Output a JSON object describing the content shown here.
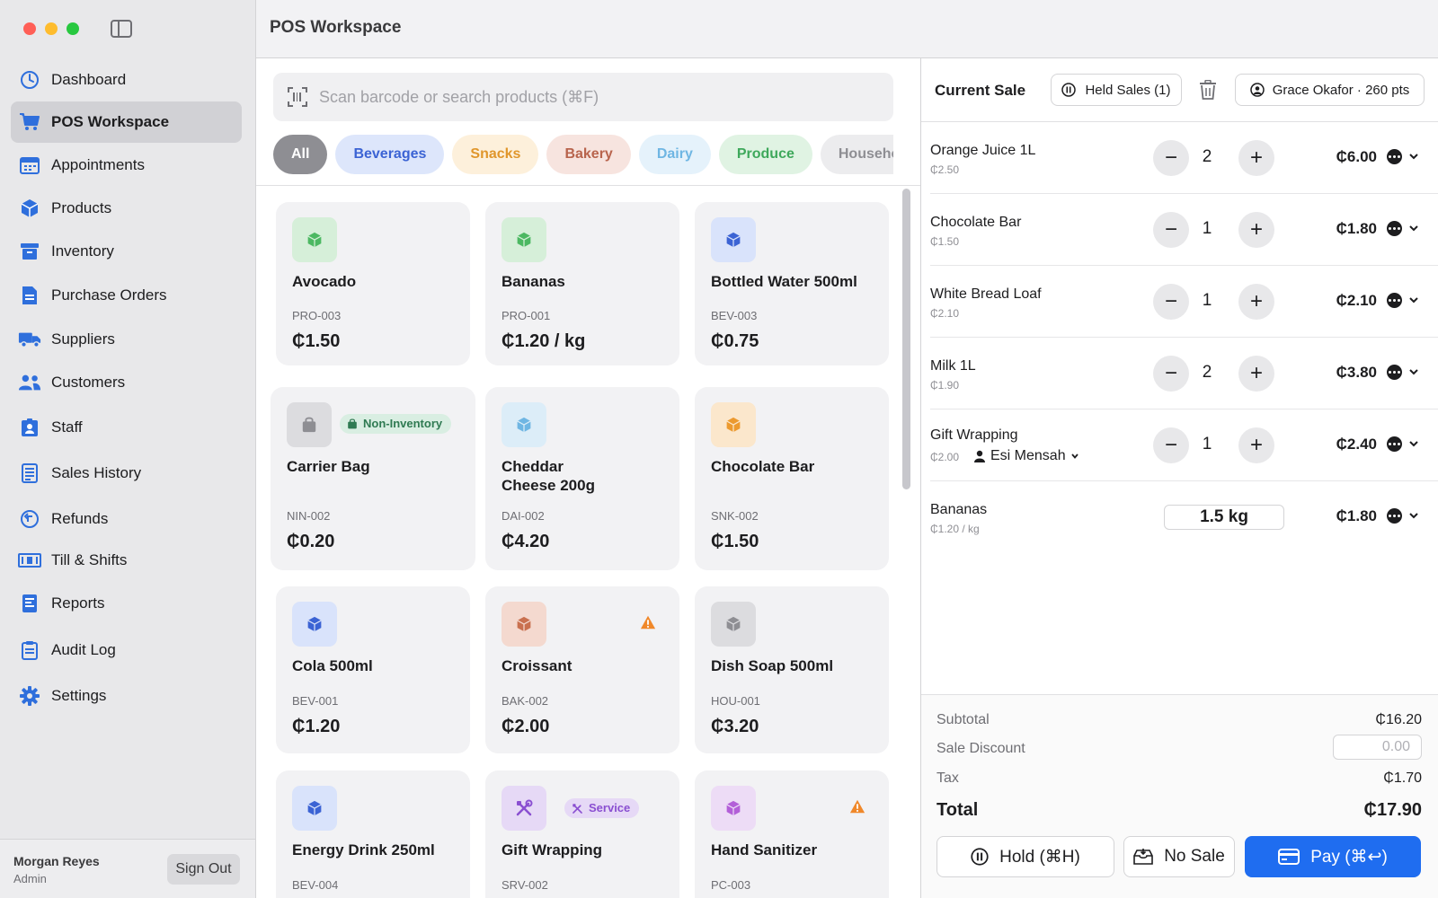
{
  "window": {
    "title": "POS Workspace"
  },
  "sidebar": {
    "items": [
      {
        "label": "Dashboard",
        "icon": "dashboard-gauge-icon"
      },
      {
        "label": "POS Workspace",
        "icon": "cart-icon",
        "active": true
      },
      {
        "label": "Appointments",
        "icon": "calendar-icon"
      },
      {
        "label": "Products",
        "icon": "cube-icon"
      },
      {
        "label": "Inventory",
        "icon": "archive-box-icon"
      },
      {
        "label": "Purchase Orders",
        "icon": "document-icon"
      },
      {
        "label": "Suppliers",
        "icon": "truck-icon"
      },
      {
        "label": "Customers",
        "icon": "people-icon"
      },
      {
        "label": "Staff",
        "icon": "id-badge-icon"
      },
      {
        "label": "Sales History",
        "icon": "receipt-list-icon"
      },
      {
        "label": "Refunds",
        "icon": "refund-arrow-icon"
      },
      {
        "label": "Till & Shifts",
        "icon": "banknote-icon"
      },
      {
        "label": "Reports",
        "icon": "report-icon"
      },
      {
        "label": "Audit Log",
        "icon": "clipboard-icon"
      },
      {
        "label": "Settings",
        "icon": "gear-icon"
      }
    ],
    "user": {
      "name": "Morgan Reyes",
      "role": "Admin",
      "signout_label": "Sign Out"
    }
  },
  "search": {
    "placeholder": "Scan barcode or search products (⌘F)"
  },
  "categories": [
    {
      "label": "All",
      "active": true
    },
    {
      "label": "Beverages"
    },
    {
      "label": "Snacks"
    },
    {
      "label": "Bakery"
    },
    {
      "label": "Dairy"
    },
    {
      "label": "Produce"
    },
    {
      "label": "Household"
    }
  ],
  "products": [
    {
      "name": "Avocado",
      "sku": "PRO-003",
      "price": "₵1.50"
    },
    {
      "name": "Bananas",
      "sku": "PRO-001",
      "price": "₵1.20 / kg"
    },
    {
      "name": "Bottled Water 500ml",
      "sku": "BEV-003",
      "price": "₵0.75"
    },
    {
      "name": "Carrier Bag",
      "sku": "NIN-002",
      "price": "₵0.20",
      "badge": "Non-Inventory"
    },
    {
      "name": "Cheddar Cheese 200g",
      "sku": "DAI-002",
      "price": "₵4.20"
    },
    {
      "name": "Chocolate Bar",
      "sku": "SNK-002",
      "price": "₵1.50"
    },
    {
      "name": "Cola 500ml",
      "sku": "BEV-001",
      "price": "₵1.20"
    },
    {
      "name": "Croissant",
      "sku": "BAK-002",
      "price": "₵2.00",
      "low_stock": true
    },
    {
      "name": "Dish Soap 500ml",
      "sku": "HOU-001",
      "price": "₵3.20"
    },
    {
      "name": "Energy Drink 250ml",
      "sku": "BEV-004",
      "price": ""
    },
    {
      "name": "Gift Wrapping",
      "sku": "SRV-002",
      "price": "",
      "badge": "Service"
    },
    {
      "name": "Hand Sanitizer",
      "sku": "PC-003",
      "price": "",
      "low_stock": true
    }
  ],
  "sale": {
    "title": "Current Sale",
    "held_label": "Held Sales (1)",
    "customer_label": "Grace Okafor · 260 pts",
    "lines": [
      {
        "name": "Orange Juice 1L",
        "unit": "₵2.50",
        "qty": "2",
        "total": "₵6.00"
      },
      {
        "name": "Chocolate Bar",
        "unit": "₵1.50",
        "qty": "1",
        "total": "₵1.80"
      },
      {
        "name": "White Bread Loaf",
        "unit": "₵2.10",
        "qty": "1",
        "total": "₵2.10"
      },
      {
        "name": "Milk 1L",
        "unit": "₵1.90",
        "qty": "2",
        "total": "₵3.80"
      },
      {
        "name": "Gift Wrapping",
        "unit": "₵2.00",
        "qty": "1",
        "total": "₵2.40",
        "assignee": "Esi Mensah"
      },
      {
        "name": "Bananas",
        "unit": "₵1.20 / kg",
        "weight": "1.5 kg",
        "total": "₵1.80"
      }
    ],
    "subtotal_label": "Subtotal",
    "subtotal": "₵16.20",
    "discount_label": "Sale Discount",
    "discount_placeholder": "0.00",
    "tax_label": "Tax",
    "tax": "₵1.70",
    "total_label": "Total",
    "total": "₵17.90",
    "hold_label": "Hold (⌘H)",
    "nosale_label": "No Sale",
    "pay_label": "Pay (⌘↩)"
  },
  "colors": {
    "accent": "#1f6df0",
    "active_nav": "#d1d1d5",
    "nav_icon": "#2f6fdc",
    "warning": "#f0882a"
  }
}
